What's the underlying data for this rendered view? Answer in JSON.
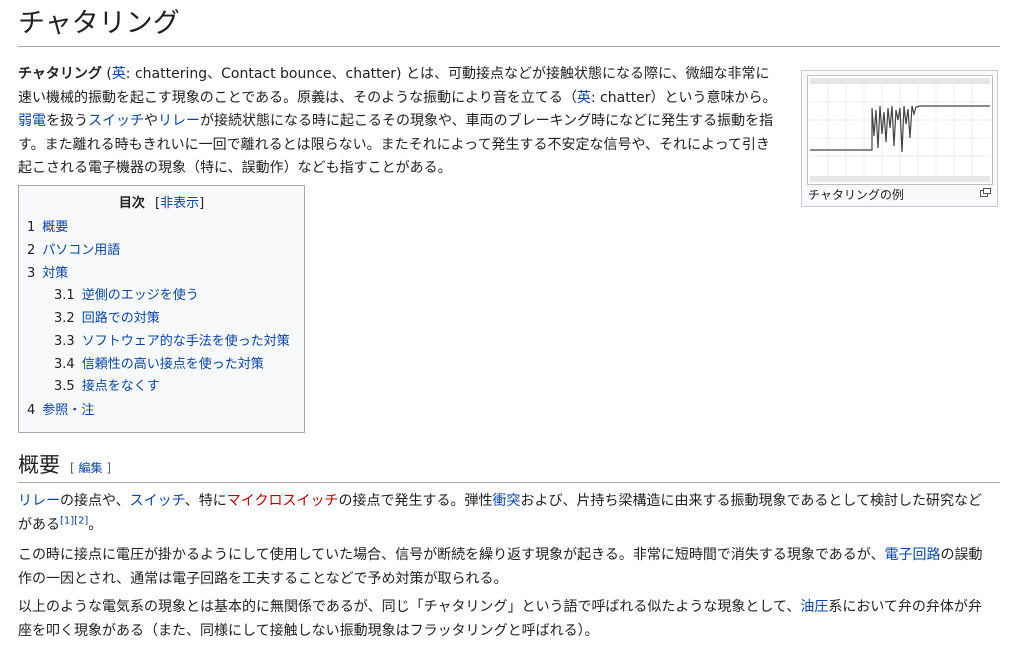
{
  "title": "チャタリング",
  "lead": {
    "term": "チャタリング",
    "p1": " (",
    "en": "英",
    "p2": ": chattering、Contact bounce、chatter) とは、可動接点などが接触状態になる際に、微細な非常に速い機械的振動を起こす現象のことである。原義は、そのような振動により音を立てる（",
    "en2": "英",
    "p3": ": chatter）という意味から。",
    "link_weak": "弱電",
    "p4": "を扱う",
    "link_switch": "スイッチ",
    "p5": "や",
    "link_relay": "リレー",
    "p6": "が接続状態になる時に起こるその現象や、車両のブレーキング時になどに発生する振動を指す。また離れる時もきれいに一回で離れるとは限らない。またそれによって発生する不安定な信号や、それによって引き起こされる電子機器の現象（特に、誤動作）なども指すことがある。"
  },
  "thumb": {
    "caption": "チャタリングの例",
    "magnify_icon": "magnify-icon"
  },
  "toc": {
    "title": "目次",
    "toggle_open": "[",
    "toggle": "非表示",
    "toggle_close": "]",
    "items": [
      {
        "num": "1",
        "label": "概要"
      },
      {
        "num": "2",
        "label": "パソコン用語"
      },
      {
        "num": "3",
        "label": "対策"
      },
      {
        "num": "3.1",
        "label": "逆側のエッジを使う"
      },
      {
        "num": "3.2",
        "label": "回路での対策"
      },
      {
        "num": "3.3",
        "label": "ソフトウェア的な手法を使った対策"
      },
      {
        "num": "3.4",
        "label": "信頼性の高い接点を使った対策"
      },
      {
        "num": "3.5",
        "label": "接点をなくす"
      },
      {
        "num": "4",
        "label": "参照・注"
      }
    ]
  },
  "section": {
    "heading": "概要",
    "edit_open": "[ ",
    "edit": "編集",
    "edit_close": " ]"
  },
  "body": {
    "para1": {
      "l_relay": "リレー",
      "t1": "の接点や、",
      "l_switch": "スイッチ",
      "t2": "、特に",
      "l_micro": "マイクロスイッチ",
      "t3": "の接点で発生する。弾性",
      "l_impact": "衝突",
      "t4": "および、片持ち梁構造に由来する振動現象であるとして検討した研究などがある",
      "ref1": "[1]",
      "ref2": "[2]",
      "t5": "。"
    },
    "para2": {
      "t1": "この時に接点に電圧が掛かるようにして使用していた場合、信号が断続を繰り返す現象が起きる。非常に短時間で消失する現象であるが、",
      "l_circuit": "電子回路",
      "t2": "の誤動作の一因とされ、通常は電子回路を工夫することなどで予め対策が取られる。"
    },
    "para3": {
      "t1": "以上のような電気系の現象とは基本的に無関係であるが、同じ「チャタリング」という語で呼ばれる似たような現象として、",
      "l_hydraulic": "油圧",
      "t2": "系において弁の弁体が弁座を叩く現象がある（また、同様にして接触しない振動現象はフラッタリングと呼ばれる）。"
    }
  }
}
